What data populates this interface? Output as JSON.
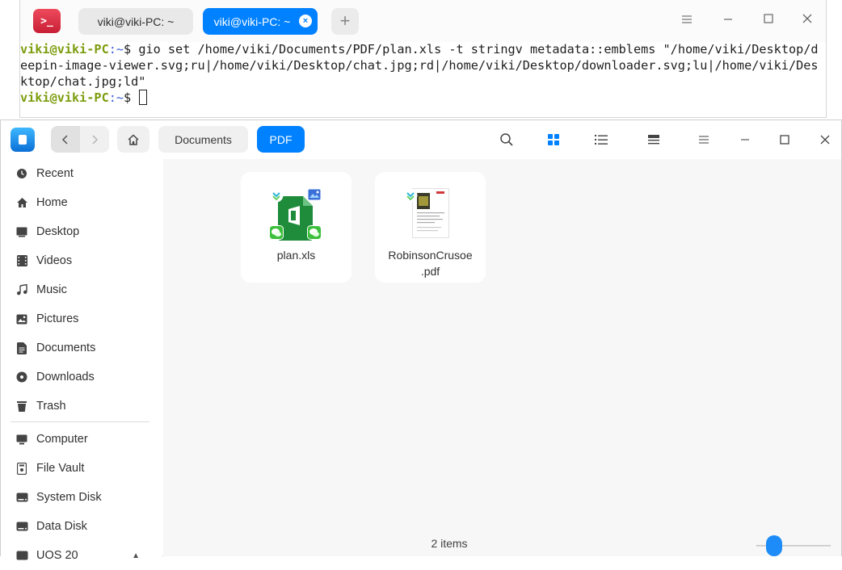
{
  "terminal": {
    "tabs": [
      {
        "label": "viki@viki-PC: ~",
        "active": false
      },
      {
        "label": "viki@viki-PC: ~",
        "active": true
      }
    ],
    "add_tab": "+",
    "close_tab": "×",
    "prompt_user": "viki@viki-PC",
    "prompt_path": ":~",
    "prompt_symbol": "$ ",
    "command": "gio set /home/viki/Documents/PDF/plan.xls -t stringv metadata::emblems \"/home/viki/Desktop/deepin-image-viewer.svg;ru|/home/viki/Desktop/chat.jpg;rd|/home/viki/Desktop/downloader.svg;lu|/home/viki/Desktop/chat.jpg;ld\""
  },
  "file_manager": {
    "breadcrumbs": [
      "Documents",
      "PDF"
    ],
    "sidebar": {
      "items": [
        {
          "label": "Recent",
          "icon": "clock-icon"
        },
        {
          "label": "Home",
          "icon": "home-icon"
        },
        {
          "label": "Desktop",
          "icon": "desktop-icon"
        },
        {
          "label": "Videos",
          "icon": "video-icon"
        },
        {
          "label": "Music",
          "icon": "music-icon"
        },
        {
          "label": "Pictures",
          "icon": "picture-icon"
        },
        {
          "label": "Documents",
          "icon": "document-icon"
        },
        {
          "label": "Downloads",
          "icon": "download-icon"
        },
        {
          "label": "Trash",
          "icon": "trash-icon"
        }
      ],
      "devices": [
        {
          "label": "Computer",
          "icon": "computer-icon"
        },
        {
          "label": "File Vault",
          "icon": "vault-icon"
        },
        {
          "label": "System Disk",
          "icon": "disk-icon"
        },
        {
          "label": "Data Disk",
          "icon": "disk-icon"
        },
        {
          "label": "UOS 20",
          "icon": "disk-icon"
        }
      ]
    },
    "files": [
      {
        "name": "plan.xls",
        "type": "spreadsheet"
      },
      {
        "name": "RobinsonCrusoe.pdf",
        "name_line1": "RobinsonCrusoe",
        "name_line2": ".pdf",
        "type": "pdf"
      }
    ],
    "status": "2 items",
    "accent": "#0081ff"
  }
}
